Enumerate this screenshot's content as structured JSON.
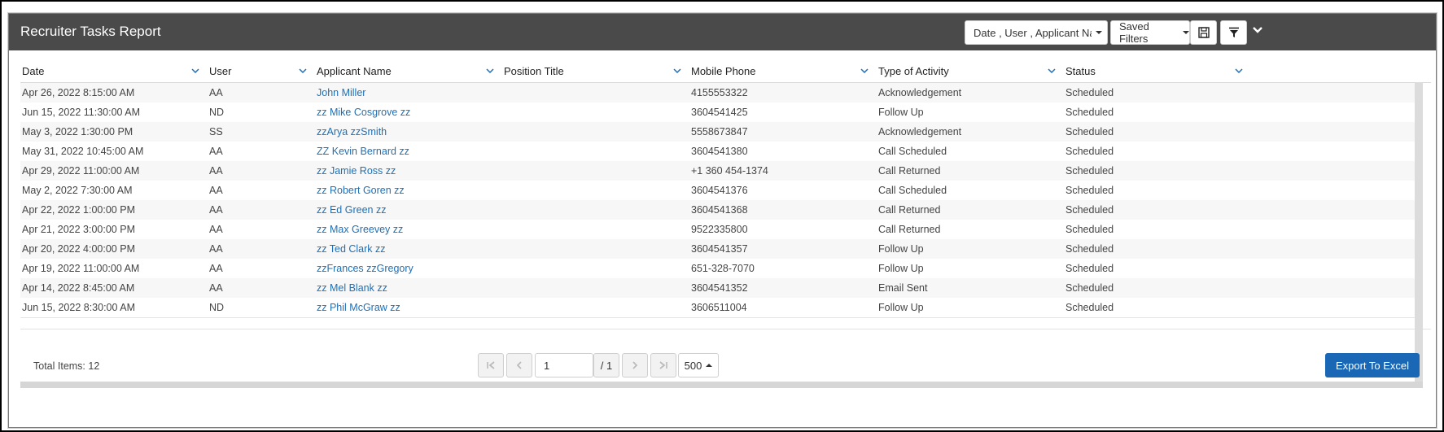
{
  "report": {
    "title": "Recruiter Tasks Report",
    "columns_selector_label": "Date , User , Applicant Name",
    "saved_filters_label": "Saved Filters"
  },
  "icons": {
    "save": "floppy-disk-icon",
    "filter": "funnel-icon",
    "collapse": "chevron-down-icon"
  },
  "table": {
    "headers": [
      "Date",
      "User",
      "Applicant Name",
      "Position Title",
      "Mobile Phone",
      "Type of Activity",
      "Status"
    ],
    "rows": [
      {
        "date": "Apr 26, 2022 8:15:00 AM",
        "user": "AA",
        "applicant": "John Miller",
        "position": "",
        "phone": "4155553322",
        "activity": "Acknowledgement",
        "status": "Scheduled"
      },
      {
        "date": "Jun 15, 2022 11:30:00 AM",
        "user": "ND",
        "applicant": "zz Mike Cosgrove zz",
        "position": "",
        "phone": "3604541425",
        "activity": "Follow Up",
        "status": "Scheduled"
      },
      {
        "date": "May 3, 2022 1:30:00 PM",
        "user": "SS",
        "applicant": "zzArya zzSmith",
        "position": "",
        "phone": "5558673847",
        "activity": "Acknowledgement",
        "status": "Scheduled"
      },
      {
        "date": "May 31, 2022 10:45:00 AM",
        "user": "AA",
        "applicant": "ZZ Kevin Bernard zz",
        "position": "",
        "phone": "3604541380",
        "activity": "Call Scheduled",
        "status": "Scheduled"
      },
      {
        "date": "Apr 29, 2022 11:00:00 AM",
        "user": "AA",
        "applicant": "zz Jamie Ross zz",
        "position": "",
        "phone": "+1 360 454-1374",
        "activity": "Call Returned",
        "status": "Scheduled"
      },
      {
        "date": "May 2, 2022 7:30:00 AM",
        "user": "AA",
        "applicant": "zz Robert Goren zz",
        "position": "",
        "phone": "3604541376",
        "activity": "Call Scheduled",
        "status": "Scheduled"
      },
      {
        "date": "Apr 22, 2022 1:00:00 PM",
        "user": "AA",
        "applicant": "zz Ed Green zz",
        "position": "",
        "phone": "3604541368",
        "activity": "Call Returned",
        "status": "Scheduled"
      },
      {
        "date": "Apr 21, 2022 3:00:00 PM",
        "user": "AA",
        "applicant": "zz Max Greevey zz",
        "position": "",
        "phone": "9522335800",
        "activity": "Call Returned",
        "status": "Scheduled"
      },
      {
        "date": "Apr 20, 2022 4:00:00 PM",
        "user": "AA",
        "applicant": "zz Ted Clark zz",
        "position": "",
        "phone": "3604541357",
        "activity": "Follow Up",
        "status": "Scheduled"
      },
      {
        "date": "Apr 19, 2022 11:00:00 AM",
        "user": "AA",
        "applicant": "zzFrances zzGregory",
        "position": "",
        "phone": "651-328-7070",
        "activity": "Follow Up",
        "status": "Scheduled"
      },
      {
        "date": "Apr 14, 2022 8:45:00 AM",
        "user": "AA",
        "applicant": "zz Mel Blank zz",
        "position": "",
        "phone": "3604541352",
        "activity": "Email Sent",
        "status": "Scheduled"
      },
      {
        "date": "Jun 15, 2022 8:30:00 AM",
        "user": "ND",
        "applicant": "zz Phil McGraw zz",
        "position": "",
        "phone": "3606511004",
        "activity": "Follow Up",
        "status": "Scheduled"
      }
    ]
  },
  "footer": {
    "total_items": "Total Items: 12",
    "page_value": "1",
    "page_total": "/ 1",
    "page_size": "500",
    "export_label": "Export To Excel"
  },
  "colors": {
    "titlebar": "#4a4a4a",
    "link": "#1f6fb5",
    "export_button": "#1a67b5"
  }
}
